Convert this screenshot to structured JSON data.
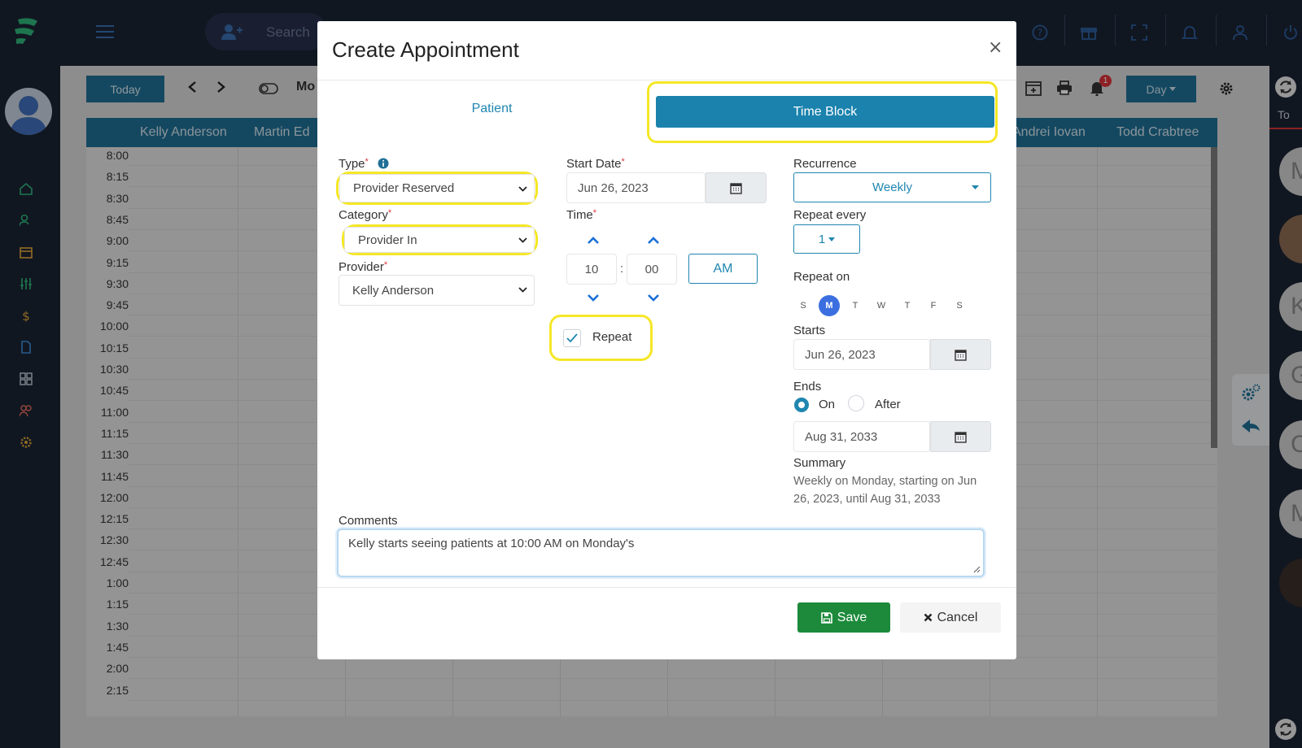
{
  "app": {
    "search_placeholder": "Search",
    "today_label": "Today",
    "month_label": "Mo",
    "day_view_label": "Day",
    "notification_count": "1",
    "providers": [
      "Kelly Anderson",
      "Martin Ed",
      "Andrei Iovan",
      "Todd Crabtree"
    ],
    "times": [
      "8:00",
      "8:15",
      "8:30",
      "8:45",
      "9:00",
      "9:15",
      "9:30",
      "9:45",
      "10:00",
      "10:15",
      "10:30",
      "10:45",
      "11:00",
      "11:15",
      "11:30",
      "11:45",
      "12:00",
      "12:15",
      "12:30",
      "12:45",
      "1:00",
      "1:15",
      "1:30",
      "1:45",
      "2:00",
      "2:15"
    ],
    "right_avatars": [
      "M",
      "",
      "K",
      "G",
      "C",
      "M",
      ""
    ],
    "right_partial_text": "To"
  },
  "modal": {
    "title": "Create Appointment",
    "close_glyph": "×",
    "tabs": {
      "patient": "Patient",
      "time_block": "Time Block"
    },
    "type": {
      "label": "Type",
      "value": "Provider Reserved"
    },
    "category": {
      "label": "Category",
      "value": "Provider In"
    },
    "provider": {
      "label": "Provider",
      "value": "Kelly Anderson"
    },
    "start_date": {
      "label": "Start Date",
      "value": "Jun 26, 2023"
    },
    "time": {
      "label": "Time",
      "hour": "10",
      "separator": ":",
      "minute": "00",
      "period": "AM"
    },
    "repeat": {
      "label": "Repeat",
      "checked": true
    },
    "recurrence": {
      "label": "Recurrence",
      "value": "Weekly"
    },
    "repeat_every": {
      "label": "Repeat every",
      "value": "1"
    },
    "repeat_on": {
      "label": "Repeat on",
      "days": [
        "S",
        "M",
        "T",
        "W",
        "T",
        "F",
        "S"
      ],
      "selected_index": 1
    },
    "starts": {
      "label": "Starts",
      "value": "Jun 26, 2023"
    },
    "ends": {
      "label": "Ends",
      "on_label": "On",
      "after_label": "After",
      "selected": "On",
      "value": "Aug 31, 2033"
    },
    "summary": {
      "label": "Summary",
      "text": "Weekly on Monday, starting on Jun 26, 2023, until Aug 31, 2033"
    },
    "comments": {
      "label": "Comments",
      "value": "Kelly starts seeing patients at 10:00 AM on Monday's"
    },
    "save_label": "Save",
    "cancel_label": "Cancel"
  },
  "colors": {
    "accent": "#1a82ad",
    "highlight": "#f5e726",
    "save": "#1c8a3a",
    "navy": "#1b2433"
  }
}
